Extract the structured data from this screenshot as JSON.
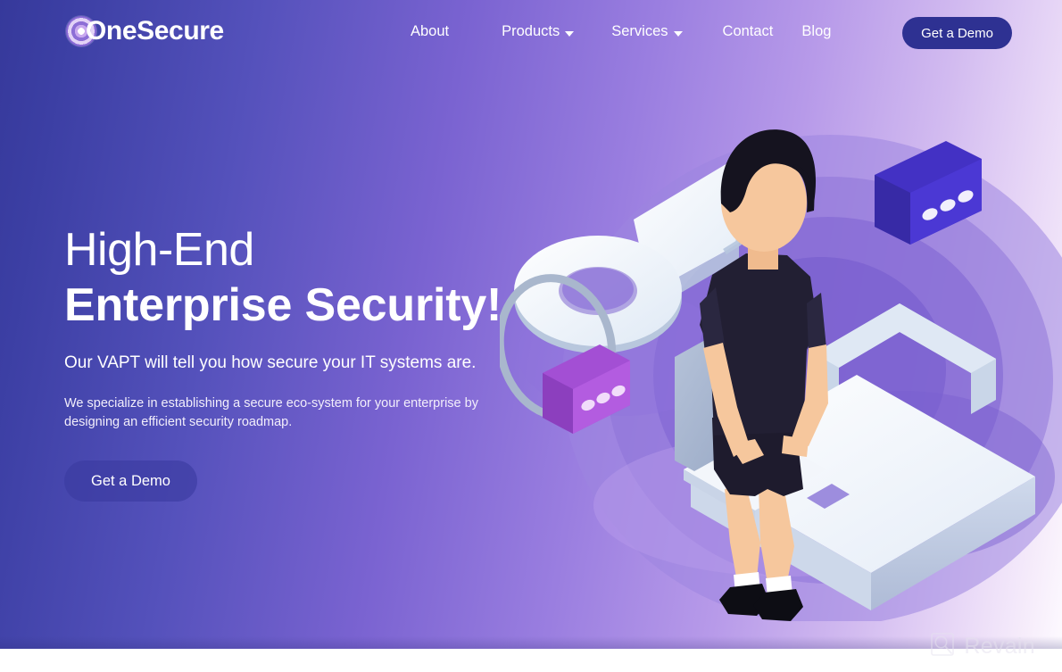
{
  "brand": {
    "name": "OneSecure",
    "mark_icon": "target-rings-icon"
  },
  "nav": {
    "items": [
      {
        "label": "About",
        "has_dropdown": false,
        "icon": ""
      },
      {
        "label": "Products",
        "has_dropdown": true,
        "icon": "chevron-down-icon"
      },
      {
        "label": "Services",
        "has_dropdown": true,
        "icon": "chevron-down-icon"
      },
      {
        "label": "Contact",
        "has_dropdown": false,
        "icon": ""
      },
      {
        "label": "Blog",
        "has_dropdown": false,
        "icon": ""
      }
    ]
  },
  "header": {
    "cta_label": "Get a Demo"
  },
  "hero": {
    "headline_line1": "High-End",
    "headline_line2": "Enterprise Security!",
    "subheadline": "Our VAPT will tell you how secure your IT systems are.",
    "body": "We specialize in establishing a secure eco-system for your enterprise by designing an efficient security roadmap.",
    "cta_label": "Get a Demo"
  },
  "illustration": {
    "alt": "Isometric illustration of a person sitting on a padlock using a laptop, with a key, magnifier ring and chat bubbles",
    "elements": [
      "background-rings",
      "key-icon",
      "padlock-icon",
      "laptop-icon",
      "person-figure",
      "chat-bubble-indigo",
      "chat-bubble-magenta"
    ]
  },
  "watermark": {
    "text": "Revain",
    "icon": "magnifier-square-icon"
  },
  "colors": {
    "gradient_start": "#36399b",
    "gradient_mid": "#9a7ee0",
    "gradient_end": "#fdfaff",
    "cta_header_bg": "#2e3192",
    "cta_hero_bg": "rgba(58,58,160,0.62)",
    "text_on_hero": "#ffffff",
    "chat_indigo": "#4331c4",
    "chat_magenta": "#b35ce0",
    "person_shirt": "#221f33",
    "skin": "#f4c49a"
  }
}
